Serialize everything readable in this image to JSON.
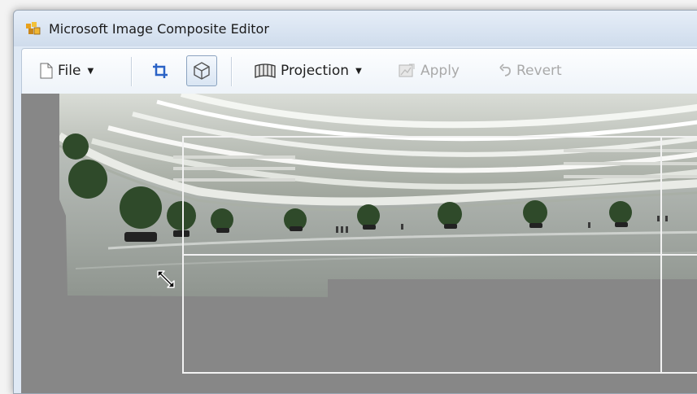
{
  "window": {
    "title": "Microsoft Image Composite Editor",
    "app_icon": "ice-app-icon"
  },
  "toolbar": {
    "file_label": "File",
    "crop_icon": "crop-icon",
    "auto_crop_icon": "cube-icon",
    "projection_label": "Projection",
    "apply_label": "Apply",
    "revert_label": "Revert"
  },
  "canvas": {
    "background": "#878787",
    "crop_color": "#f2f2f2",
    "cursor": "resize-diagonal-cursor"
  }
}
